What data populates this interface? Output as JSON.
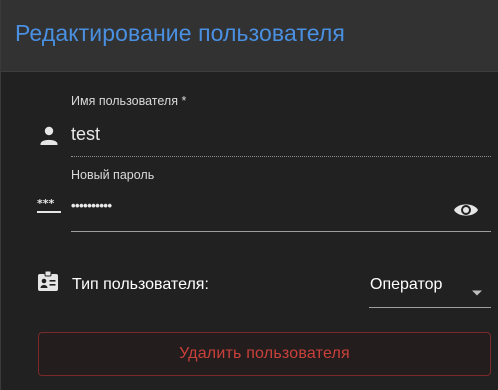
{
  "dialog": {
    "title": "Редактирование пользователя"
  },
  "username": {
    "label": "Имя пользователя *",
    "value": "test",
    "icon": "person-icon"
  },
  "password": {
    "label": "Новый пароль",
    "value": "••••••••••",
    "icon": "password-icon",
    "toggle_icon": "eye-icon"
  },
  "user_type": {
    "label": "Тип пользователя:",
    "selected": "Оператор",
    "icon": "badge-icon"
  },
  "delete_button": {
    "label": "Удалить пользователя",
    "color": "#c9413a"
  },
  "colors": {
    "title": "#4a90e2",
    "background": "#212121",
    "header": "#323232"
  }
}
